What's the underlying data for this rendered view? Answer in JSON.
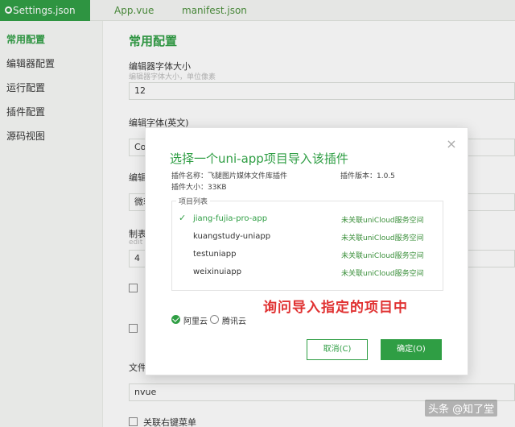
{
  "tabs": [
    {
      "label": "Settings.json",
      "active": true
    },
    {
      "label": "App.vue",
      "active": false
    },
    {
      "label": "manifest.json",
      "active": false
    }
  ],
  "nav": {
    "items": [
      {
        "label": "常用配置",
        "active": true
      },
      {
        "label": "编辑器配置",
        "active": false
      },
      {
        "label": "运行配置",
        "active": false
      },
      {
        "label": "插件配置",
        "active": false
      },
      {
        "label": "源码视图",
        "active": false
      }
    ]
  },
  "content": {
    "section_title": "常用配置",
    "font_size_label": "编辑器字体大小",
    "font_size_hint": "编辑器字体大小，单位像素",
    "font_size_value": "12",
    "font_en_label": "编辑字体(英文)",
    "font_en_value": "Co",
    "font_cn_label": "编辑",
    "font_cn_value": "微软",
    "tab_label": "制表",
    "tab_hint": "edit",
    "tab_value": "4",
    "check1_label": "",
    "check2_label": "",
    "file_label": "文件",
    "file_value": "nvue",
    "context_menu_label": "关联右键菜单"
  },
  "modal": {
    "title": "选择一个uni-app项目导入该插件",
    "plugin_name_label": "插件名称：飞腿图片媒体文件库插件",
    "plugin_version_label": "插件版本：1.0.5",
    "plugin_size_label": "插件大小：33KB",
    "list_legend": "项目列表",
    "projects": [
      {
        "name": "jiang-fujia-pro-app",
        "status": "未关联uniCloud服务空间",
        "selected": true
      },
      {
        "name": "kuangstudy-uniapp",
        "status": "未关联uniCloud服务空间",
        "selected": false
      },
      {
        "name": "testuniapp",
        "status": "未关联uniCloud服务空间",
        "selected": false
      },
      {
        "name": "weixinuiapp",
        "status": "未关联uniCloud服务空间",
        "selected": false
      }
    ],
    "check_glyph": "✓",
    "cloud_options": [
      {
        "label": "阿里云",
        "selected": true
      },
      {
        "label": "腾讯云",
        "selected": false
      }
    ],
    "cancel_label": "取消(C)",
    "ok_label": "确定(O)",
    "close_glyph": "×"
  },
  "annotation": "询问导入指定的项目中",
  "watermark": "头条 @知了堂",
  "colors": {
    "accent": "#2f9e44",
    "annotation": "#e03131"
  }
}
